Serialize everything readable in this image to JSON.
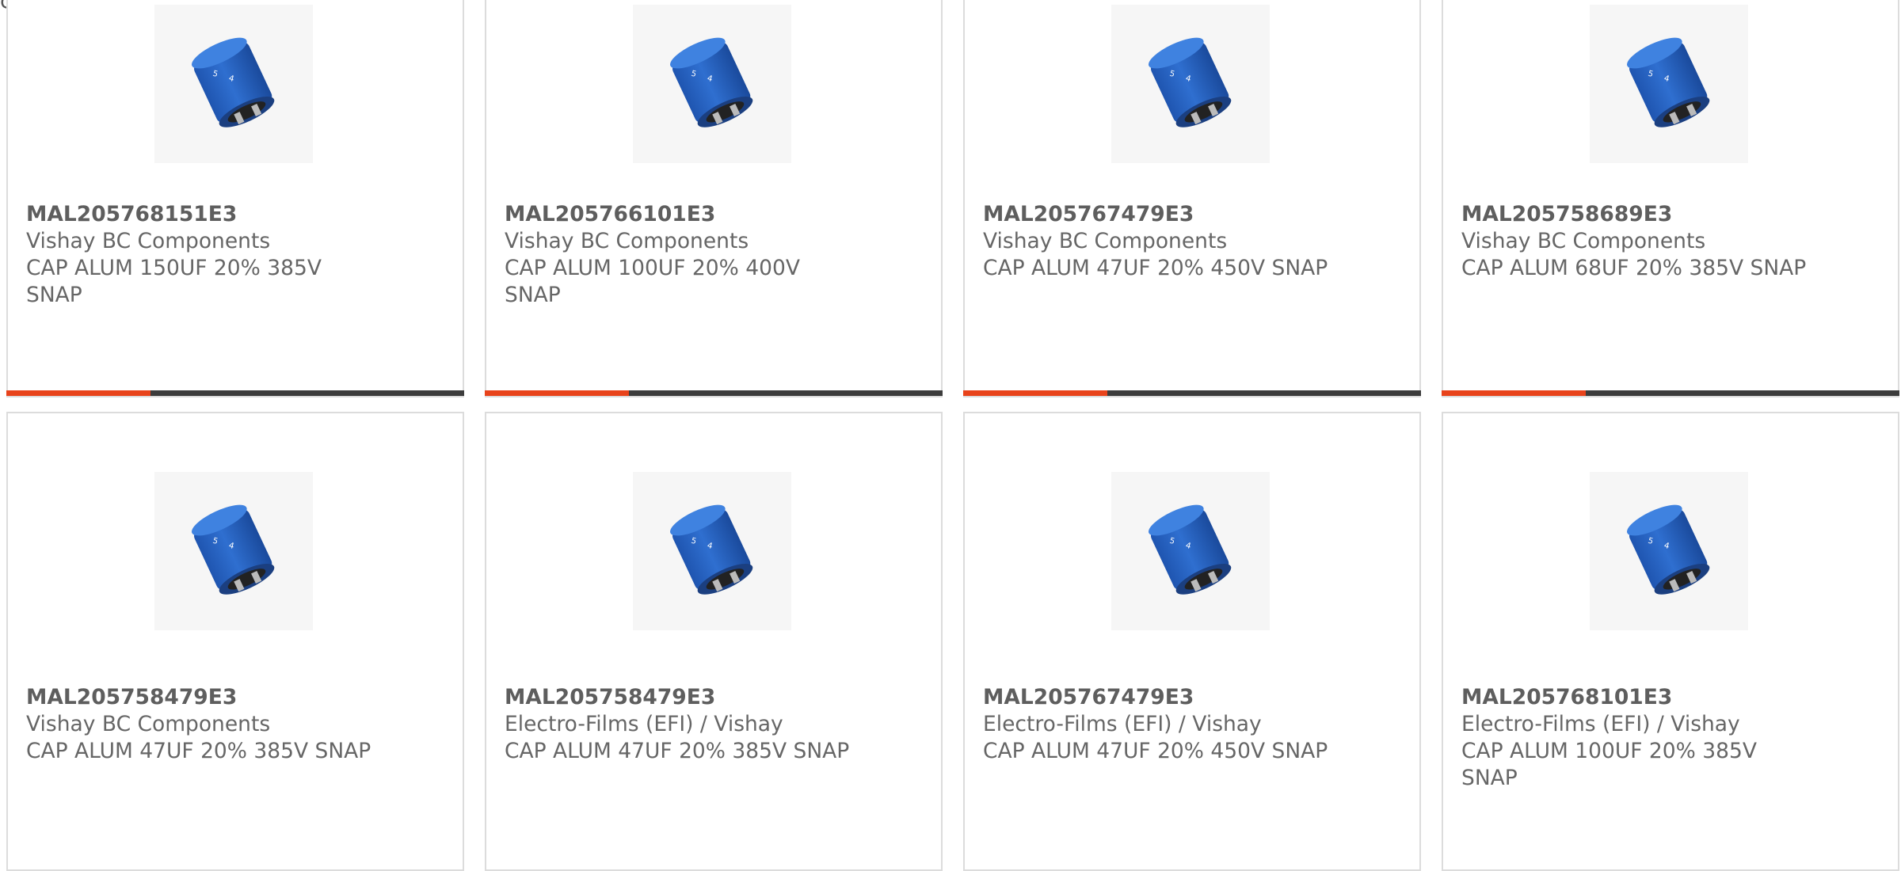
{
  "top_clipped_text": "com",
  "products": [
    {
      "part_number": "MAL205768151E3",
      "manufacturer": "Vishay BC Components",
      "description": "CAP ALUM 150UF 20% 385V SNAP",
      "image": "blue-snap-in-capacitor"
    },
    {
      "part_number": "MAL205766101E3",
      "manufacturer": "Vishay BC Components",
      "description": "CAP ALUM 100UF 20% 400V SNAP",
      "image": "blue-snap-in-capacitor"
    },
    {
      "part_number": "MAL205767479E3",
      "manufacturer": "Vishay BC Components",
      "description": "CAP ALUM 47UF 20% 450V SNAP",
      "image": "blue-snap-in-capacitor"
    },
    {
      "part_number": "MAL205758689E3",
      "manufacturer": "Vishay BC Components",
      "description": "CAP ALUM 68UF 20% 385V SNAP",
      "image": "blue-snap-in-capacitor"
    },
    {
      "part_number": "MAL205758479E3",
      "manufacturer": "Vishay BC Components",
      "description": "CAP ALUM 47UF 20% 385V SNAP",
      "image": "blue-snap-in-capacitor"
    },
    {
      "part_number": "MAL205758479E3",
      "manufacturer": "Electro-Films (EFI) / Vishay",
      "description": "CAP ALUM 47UF 20% 385V SNAP",
      "image": "blue-snap-in-capacitor"
    },
    {
      "part_number": "MAL205767479E3",
      "manufacturer": "Electro-Films (EFI) / Vishay",
      "description": "CAP ALUM 47UF 20% 450V SNAP",
      "image": "blue-snap-in-capacitor"
    },
    {
      "part_number": "MAL205768101E3",
      "manufacturer": "Electro-Films (EFI) / Vishay",
      "description": "CAP ALUM 100UF 20% 385V SNAP",
      "image": "blue-snap-in-capacitor"
    }
  ],
  "colors": {
    "accent": "#e8431b",
    "bar": "#3c3c3c",
    "capacitor": "#2f6fd0"
  }
}
